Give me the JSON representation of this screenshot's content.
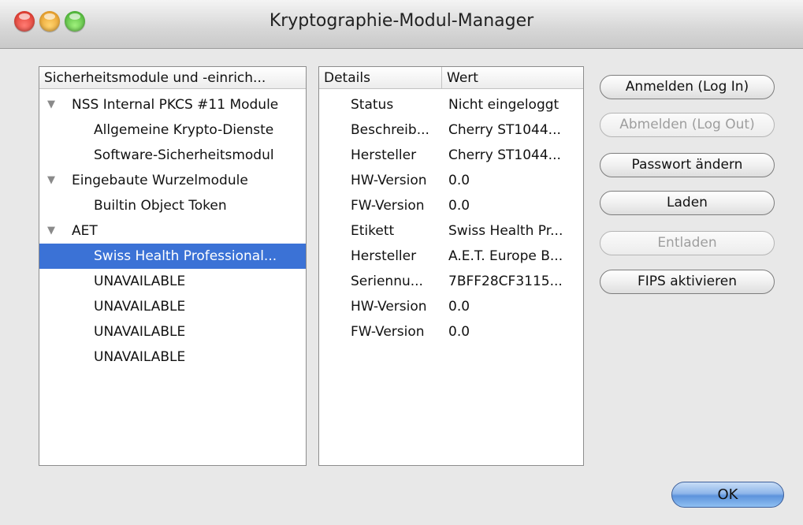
{
  "window": {
    "title": "Kryptographie-Modul-Manager"
  },
  "modules": {
    "column_header": "Sicherheitsmodule und -einrich...",
    "items": [
      {
        "label": "NSS Internal PKCS #11 Module",
        "level": 0,
        "expanded": true
      },
      {
        "label": "Allgemeine Krypto-Dienste",
        "level": 1
      },
      {
        "label": "Software-Sicherheitsmodul",
        "level": 1
      },
      {
        "label": "Eingebaute Wurzelmodule",
        "level": 0,
        "expanded": true
      },
      {
        "label": "Builtin Object Token",
        "level": 1
      },
      {
        "label": "AET",
        "level": 0,
        "expanded": true
      },
      {
        "label": "Swiss Health Professional...",
        "level": 1,
        "selected": true
      },
      {
        "label": "UNAVAILABLE",
        "level": 1
      },
      {
        "label": "UNAVAILABLE",
        "level": 1
      },
      {
        "label": "UNAVAILABLE",
        "level": 1
      },
      {
        "label": "UNAVAILABLE",
        "level": 1
      }
    ]
  },
  "details": {
    "header_details": "Details",
    "header_value": "Wert",
    "rows": [
      {
        "key": "Status",
        "value": "Nicht eingeloggt"
      },
      {
        "key": "Beschreib...",
        "value": "Cherry ST1044..."
      },
      {
        "key": "Hersteller",
        "value": "Cherry ST1044..."
      },
      {
        "key": "HW-Version",
        "value": "0.0"
      },
      {
        "key": "FW-Version",
        "value": "0.0"
      },
      {
        "key": "Etikett",
        "value": "Swiss Health Pr..."
      },
      {
        "key": "Hersteller",
        "value": "A.E.T. Europe B..."
      },
      {
        "key": "Seriennu...",
        "value": "7BFF28CF3115..."
      },
      {
        "key": "HW-Version",
        "value": "0.0"
      },
      {
        "key": "FW-Version",
        "value": "0.0"
      }
    ]
  },
  "buttons": {
    "login": "Anmelden (Log In)",
    "logout": "Abmelden (Log Out)",
    "change_password": "Passwort ändern",
    "load": "Laden",
    "unload": "Entladen",
    "fips": "FIPS aktivieren",
    "ok": "OK"
  },
  "colors": {
    "selection": "#3b72d6",
    "ok_button": "#8fb6ea"
  }
}
